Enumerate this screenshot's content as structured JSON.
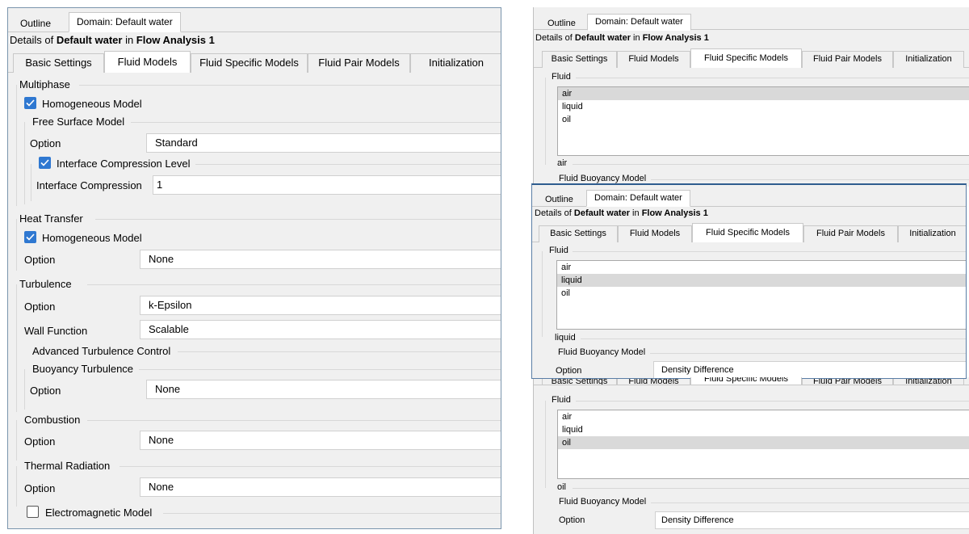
{
  "top_tabs": {
    "outline": "Outline",
    "domain": "Domain: Default water"
  },
  "details": {
    "prefix": "Details of ",
    "object": "Default water",
    "middle": " in ",
    "analysis": "Flow Analysis 1"
  },
  "sub_tabs": [
    "Basic Settings",
    "Fluid Models",
    "Fluid Specific Models",
    "Fluid Pair Models",
    "Initialization"
  ],
  "left": {
    "multiphase": {
      "title": "Multiphase",
      "homogeneous_label": "Homogeneous Model",
      "homogeneous_checked": true,
      "free_surface_title": "Free Surface Model",
      "option_label": "Option",
      "option_value": "Standard",
      "interface_level_label": "Interface Compression Level",
      "interface_level_checked": true,
      "interface_compression_label": "Interface Compression",
      "interface_compression_value": "1"
    },
    "heat_transfer": {
      "title": "Heat Transfer",
      "homogeneous_label": "Homogeneous Model",
      "homogeneous_checked": true,
      "option_label": "Option",
      "option_value": "None"
    },
    "turbulence": {
      "title": "Turbulence",
      "option_label": "Option",
      "option_value": "k-Epsilon",
      "wall_function_label": "Wall Function",
      "wall_function_value": "Scalable",
      "advanced_title": "Advanced Turbulence Control",
      "buoyancy_title": "Buoyancy Turbulence",
      "buoyancy_option_label": "Option",
      "buoyancy_option_value": "None"
    },
    "combustion": {
      "title": "Combustion",
      "option_label": "Option",
      "option_value": "None"
    },
    "thermal_radiation": {
      "title": "Thermal Radiation",
      "option_label": "Option",
      "option_value": "None"
    },
    "electromagnetic": {
      "label": "Electromagnetic Model",
      "checked": false
    }
  },
  "right": {
    "fluid_label": "Fluid",
    "fluids": [
      "air",
      "liquid",
      "oil"
    ],
    "buoyancy_title": "Fluid Buoyancy Model",
    "option_label": "Option",
    "panel1": {
      "selected_fluid": "air",
      "selected_index": 0
    },
    "panel2": {
      "selected_fluid": "liquid",
      "selected_index": 1,
      "option_value": "Density Difference"
    },
    "panel3": {
      "selected_fluid": "oil",
      "selected_index": 2,
      "option_value": "Density Difference"
    }
  },
  "colors": {
    "checkbox_blue": "#2f78d1",
    "panel_border": "#7a95ad",
    "selection_gray": "#d9d9d9"
  }
}
